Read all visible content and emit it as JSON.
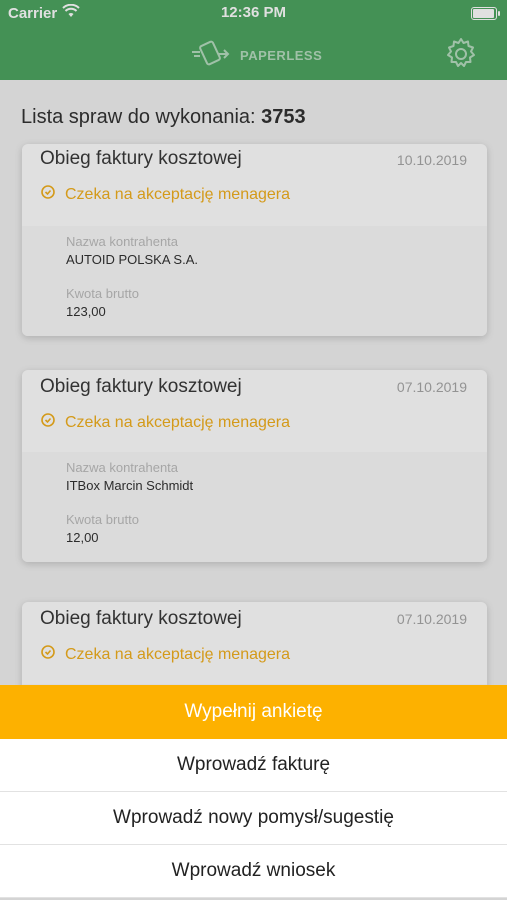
{
  "status_bar": {
    "carrier": "Carrier",
    "time": "12:36 PM",
    "battery_level": 1.0
  },
  "navbar": {
    "logo_text": "PAPERLESS",
    "logo_icon": "paperless-logo-icon",
    "settings_icon": "gear-icon"
  },
  "header": {
    "label": "Lista spraw do wykonania:",
    "count": "3753"
  },
  "cards": [
    {
      "title": "Obieg faktury kosztowej",
      "date": "10.10.2019",
      "status": "Czeka na akceptację menagera",
      "contractor_label": "Nazwa kontrahenta",
      "contractor": "AUTOID POLSKA S.A.",
      "amount_label": "Kwota brutto",
      "amount": "123,00"
    },
    {
      "title": "Obieg faktury kosztowej",
      "date": "07.10.2019",
      "status": "Czeka na akceptację menagera",
      "contractor_label": "Nazwa kontrahenta",
      "contractor": "ITBox Marcin Schmidt",
      "amount_label": "Kwota brutto",
      "amount": "12,00"
    },
    {
      "title": "Obieg faktury kosztowej",
      "date": "07.10.2019",
      "status": "Czeka na akceptację menagera"
    }
  ],
  "action_sheet": {
    "primary": "Wypełnij ankietę",
    "items": [
      "Wprowadź fakturę",
      "Wprowadź nowy pomysł/sugestię",
      "Wprowadź wniosek"
    ]
  },
  "colors": {
    "brand_green": "#4ea661",
    "accent_orange": "#fdb100",
    "status_orange": "#f2b01e"
  }
}
